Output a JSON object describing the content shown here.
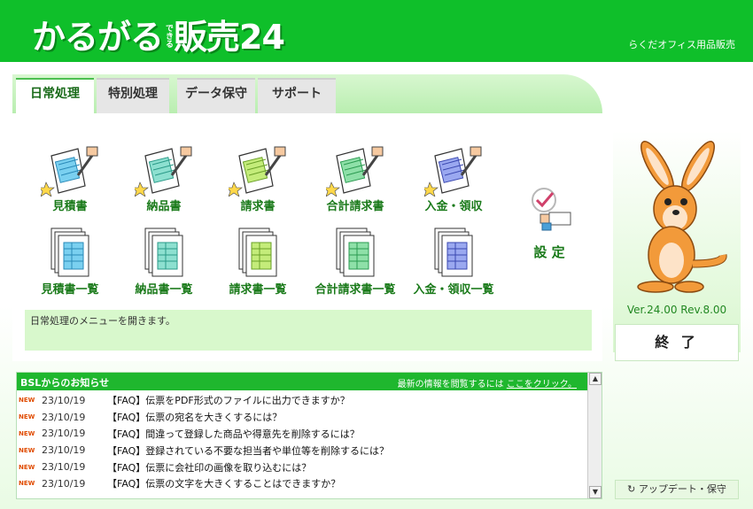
{
  "header": {
    "logo_main_1": "かるがる",
    "logo_small": "できる",
    "logo_main_2": "販売24",
    "company": "らくだオフィス用品販売",
    "bg_color": "#0fbf2a"
  },
  "tabs": [
    {
      "label": "日常処理",
      "active": true
    },
    {
      "label": "特別処理",
      "active": false
    },
    {
      "label": "データ保守",
      "active": false
    },
    {
      "label": "サポート",
      "active": false
    }
  ],
  "menu_row1": [
    {
      "label": "見積書",
      "icon": "estimate-document-icon"
    },
    {
      "label": "納品書",
      "icon": "delivery-document-icon"
    },
    {
      "label": "請求書",
      "icon": "invoice-document-icon"
    },
    {
      "label": "合計請求書",
      "icon": "total-invoice-document-icon"
    },
    {
      "label": "入金・領収",
      "icon": "payment-receipt-icon"
    }
  ],
  "menu_row2": [
    {
      "label": "見積書一覧",
      "icon": "estimate-list-icon"
    },
    {
      "label": "納品書一覧",
      "icon": "delivery-list-icon"
    },
    {
      "label": "請求書一覧",
      "icon": "invoice-list-icon"
    },
    {
      "label": "合計請求書一覧",
      "icon": "total-invoice-list-icon"
    },
    {
      "label": "入金・領収一覧",
      "icon": "payment-list-icon"
    }
  ],
  "settings": {
    "label": "設 定",
    "icon": "settings-check-icon"
  },
  "description": "日常処理のメニューを開きます。",
  "side": {
    "version": "Ver.24.00  Rev.8.00",
    "exit_label": "終 了",
    "update_label": "アップデート・保守",
    "update_icon": "refresh-icon",
    "mascot": "kangaroo-mascot-icon"
  },
  "news": {
    "heading": "BSLからのお知らせ",
    "link_prefix": "最新の情報を閲覧するには",
    "link_text": "ここをクリック。",
    "items": [
      {
        "badge": "NEW",
        "date": "23/10/19",
        "title": "【FAQ】伝票をPDF形式のファイルに出力できますか？"
      },
      {
        "badge": "NEW",
        "date": "23/10/19",
        "title": "【FAQ】伝票の宛名を大きくするには？"
      },
      {
        "badge": "NEW",
        "date": "23/10/19",
        "title": "【FAQ】間違って登録した商品や得意先を削除するには？"
      },
      {
        "badge": "NEW",
        "date": "23/10/19",
        "title": "【FAQ】登録されている不要な担当者や単位等を削除するには？"
      },
      {
        "badge": "NEW",
        "date": "23/10/19",
        "title": "【FAQ】伝票に会社印の画像を取り込むには？"
      },
      {
        "badge": "NEW",
        "date": "23/10/19",
        "title": "【FAQ】伝票の文字を大きくすることはできますか？"
      }
    ]
  }
}
